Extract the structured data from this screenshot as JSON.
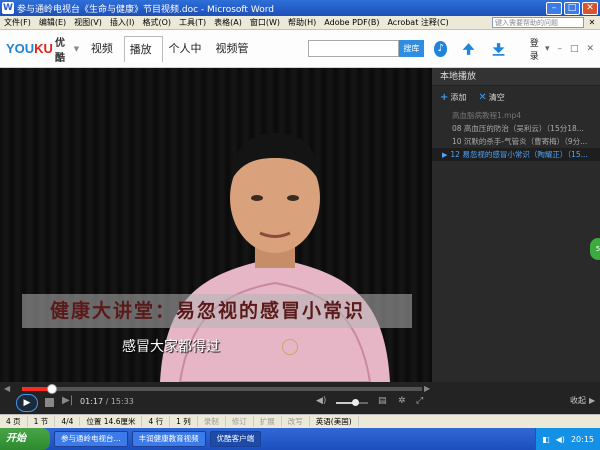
{
  "word": {
    "title": "参与通岭电视台《生命与健康》节目视频.doc - Microsoft Word",
    "menus": [
      "文件(F)",
      "编辑(E)",
      "视图(V)",
      "插入(I)",
      "格式(O)",
      "工具(T)",
      "表格(A)",
      "窗口(W)",
      "帮助(H)",
      "Adobe PDF(B)",
      "Acrobat 注释(C)"
    ],
    "help_placeholder": "键入需要帮助的问题"
  },
  "youku": {
    "logo_a": "YOU",
    "logo_b": "KU",
    "logo_sub": "优酷",
    "tabs": [
      "视频库",
      "播放器",
      "个人中心",
      "视频管理"
    ],
    "active_tab_index": 1,
    "search_button": "搜库",
    "login": "登录"
  },
  "video": {
    "banner_text": "健康大讲堂：易忽视的感冒小常识",
    "caption": "感冒大家都得过",
    "progress": 0.0757
  },
  "playlist": {
    "title": "本地播放",
    "add_label": "添加",
    "clear_label": "清空",
    "items": [
      {
        "text": "高血脂病教程1.mp4",
        "state": "dim"
      },
      {
        "text": "08 高血压的防治（吴利云）（15分18...",
        "state": "normal"
      },
      {
        "text": "10 沉默的杀手-气管炎（曹寄梅）（9分...",
        "state": "normal"
      },
      {
        "text": "12 易忽视的感冒小常识（陶耀正）（15...",
        "state": "active"
      }
    ],
    "side_bubble": "5"
  },
  "controls": {
    "current_time": "01:17",
    "total_time": "15:33",
    "volume": 0.6,
    "collapse_label": "收起"
  },
  "statusbar": {
    "items": [
      "4 页",
      "1 节",
      "4/4",
      "位置 14.6厘米",
      "4 行",
      "1 列",
      "录制",
      "修订",
      "扩展",
      "改写",
      "英语(美国)"
    ]
  },
  "taskbar": {
    "start": "开始",
    "buttons": [
      "参与通岭电视台...",
      "丰润健康教育视频",
      "优酷客户端"
    ],
    "active_index": 2,
    "clock": "20:15"
  }
}
